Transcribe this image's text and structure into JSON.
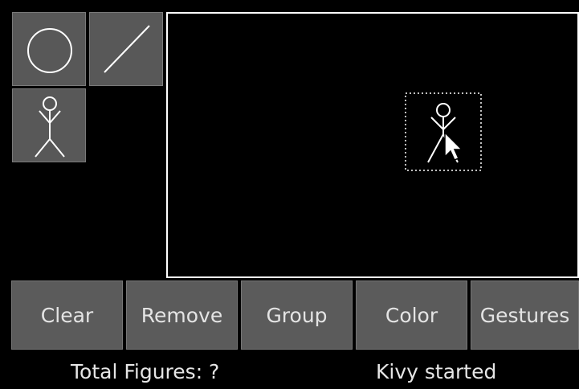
{
  "toolbox": {
    "tools": [
      {
        "icon": "circle-icon"
      },
      {
        "icon": "line-icon"
      },
      {
        "icon": "stickman-icon"
      }
    ]
  },
  "canvas": {
    "figures": [
      {
        "icon": "stickman-icon",
        "selected": true
      }
    ]
  },
  "buttons": {
    "clear": "Clear",
    "remove": "Remove",
    "group": "Group",
    "color": "Color",
    "gestures": "Gestures"
  },
  "status": {
    "figures": "Total Figures: ?",
    "message": "Kivy started"
  },
  "colors": {
    "background": "#000000",
    "button": "#5b5b5b",
    "stroke": "#ffffff",
    "text": "#e6e6e6"
  }
}
